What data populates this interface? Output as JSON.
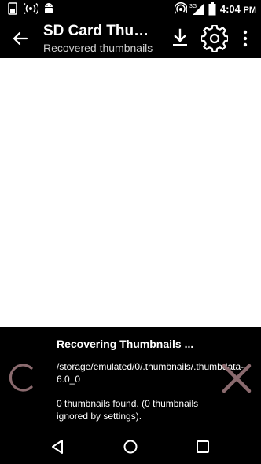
{
  "status_bar": {
    "time": "4:04",
    "time_suffix": "PM",
    "network": "3G",
    "icons": [
      "sim-icon",
      "wifi-hotspot-icon",
      "android-icon",
      "hotspot-icon",
      "signal-icon",
      "battery-icon"
    ]
  },
  "app_bar": {
    "title": "SD Card Thumbnails",
    "subtitle": "Recovered thumbnails",
    "icons": [
      "back-arrow-icon",
      "download-icon",
      "gear-icon",
      "overflow-menu-icon"
    ]
  },
  "progress": {
    "title": "Recovering Thumbnails ...",
    "path": "/storage/emulated/0/.thumbnails/.thumbdata-6.0_0",
    "count_text": "0 thumbnails found. (0 thumbnails ignored by settings).",
    "icons": [
      "loading-spinner-icon",
      "close-icon"
    ]
  },
  "nav_bar": {
    "icons": [
      "back-triangle-icon",
      "home-circle-icon",
      "recents-square-icon"
    ]
  },
  "colors": {
    "background": "#000000",
    "content": "#ffffff",
    "accent_muted": "#8a6a6e"
  }
}
